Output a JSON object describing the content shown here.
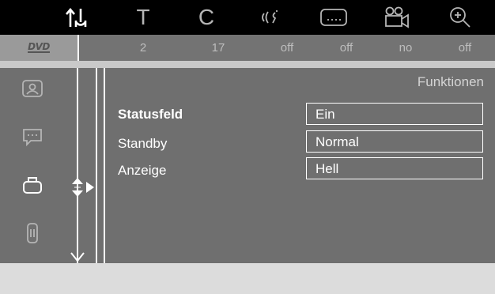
{
  "top_menu": {
    "icons": [
      {
        "name": "settings-tools-icon",
        "active": true
      },
      {
        "name": "title-icon",
        "glyph": "T"
      },
      {
        "name": "chapter-icon",
        "glyph": "C"
      },
      {
        "name": "audio-icon"
      },
      {
        "name": "subtitle-icon"
      },
      {
        "name": "camera-angle-icon"
      },
      {
        "name": "zoom-icon"
      }
    ]
  },
  "status_bar": {
    "disc_badge": "DVD",
    "values": [
      "2",
      "17",
      "off",
      "off",
      "no",
      "off"
    ]
  },
  "side_menu": {
    "items": [
      {
        "name": "picture-icon",
        "active": false
      },
      {
        "name": "sound-icon",
        "active": false
      },
      {
        "name": "features-icon",
        "active": true
      },
      {
        "name": "remote-icon",
        "active": false
      }
    ]
  },
  "panel": {
    "title": "Funktionen",
    "rows": [
      {
        "label": "Statusfeld",
        "value": "Ein",
        "selected": true
      },
      {
        "label": "Standby",
        "value": "Normal",
        "selected": false
      },
      {
        "label": "Anzeige",
        "value": "Hell",
        "selected": false
      }
    ]
  },
  "colors": {
    "topbar": "#000000",
    "statusbar": "#737373",
    "panel": "#6f6f6f",
    "text": "#ffffff",
    "dim_text": "#bdbdbd"
  }
}
